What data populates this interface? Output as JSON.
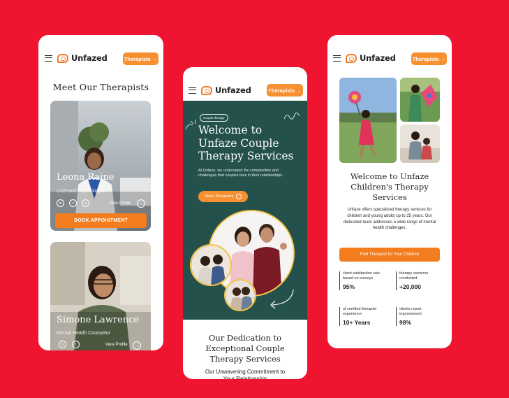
{
  "brand": {
    "name": "Unfazed",
    "accent": "#f79031",
    "background": "#ef1430",
    "hero_green": "#24514b"
  },
  "nav": {
    "cta_label": "Therapists",
    "cta_arrow": "→"
  },
  "therapists_page": {
    "title": "Meet Our Therapists",
    "cards": [
      {
        "name": "Leona Raine",
        "role": "Licensed Psychologist",
        "view_label": "View Profile",
        "book_label": "BOOK APPOINTMENT"
      },
      {
        "name": "Simone Lawrence",
        "role": "Mental Health Counselor",
        "view_label": "View Profile"
      }
    ],
    "social": [
      "in",
      "t",
      "w"
    ]
  },
  "couple_page": {
    "badge": "Couple therapy",
    "title": "Welcome to Unfaze Couple Therapy Services",
    "description": "At Unfaze, we understand the complexities and challenges that couples face in their relationships.",
    "button": "View Therapists",
    "section_title": "Our Dedication to Exceptional Couple Therapy Services",
    "section_subtitle": "Our Unwavering Commitment to Your Relationship"
  },
  "children_page": {
    "title": "Welcome to Unfaze Children's Therapy Services",
    "description": "Unfaze offers specialized therapy services for children and young adults up to 25 years. Our dedicated team addresses a wide range of mental health challenges.",
    "button": "Find Therapist for Your Children",
    "stats": [
      {
        "label": "client satisfaction rate based on surveys",
        "value": "95%"
      },
      {
        "label": "therapy sessions conducted",
        "value": "+20,000"
      },
      {
        "label": "of certified therapist experience",
        "value": "10+ Years"
      },
      {
        "label": "clients report improvement",
        "value": "98%"
      }
    ]
  }
}
